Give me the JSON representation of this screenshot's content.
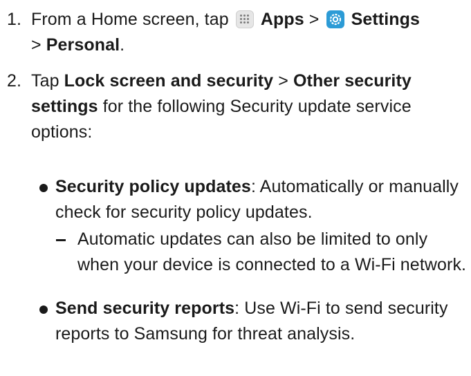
{
  "step1": {
    "number": "1.",
    "text_before": "From a Home screen, tap ",
    "apps_icon": "apps-icon",
    "apps_label": "Apps",
    "separator1": " > ",
    "settings_icon": "settings-icon",
    "settings_label": "Settings",
    "separator2": "> ",
    "personal_label": "Personal",
    "period": "."
  },
  "step2": {
    "number": "2.",
    "text_tap": "Tap ",
    "lock_label": "Lock screen and security",
    "separator": " > ",
    "other_label": "Other security settings",
    "text_after": " for the following Security update service options:"
  },
  "bullets": [
    {
      "title": "Security policy updates",
      "text": ": Automatically or manually check for security policy updates."
    },
    {
      "title": "Send security reports",
      "text": ": Use Wi-Fi to send security reports to Samsung for threat analysis."
    }
  ],
  "sub_bullets": [
    {
      "text": "Automatic updates can also be limited to only when your device is connected to a Wi-Fi network."
    }
  ]
}
